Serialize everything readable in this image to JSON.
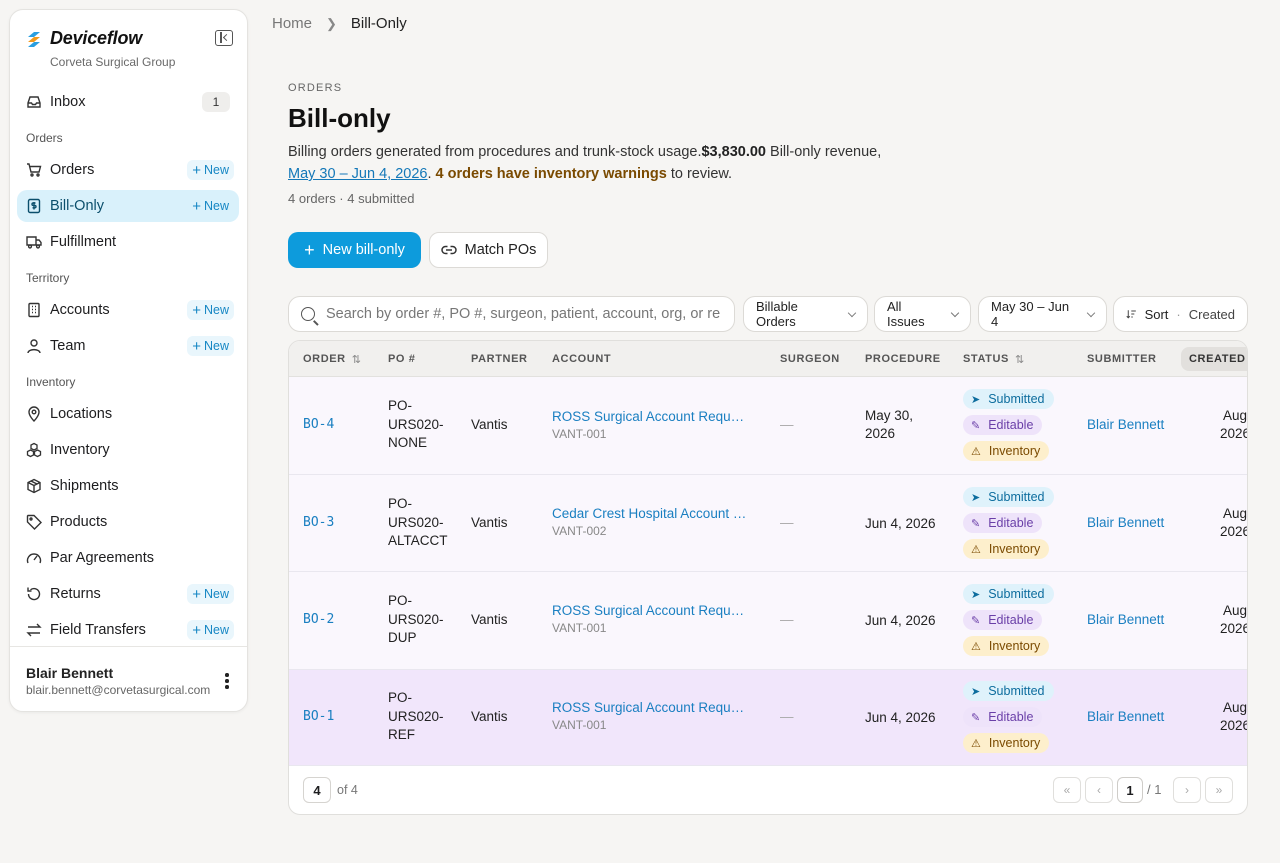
{
  "brand": {
    "name": "Deviceflow",
    "org": "Corveta Surgical Group"
  },
  "sidebar": {
    "inbox": {
      "label": "Inbox",
      "count": "1"
    },
    "sections": {
      "orders": "Orders",
      "territory": "Territory",
      "inventory": "Inventory"
    },
    "new_label": "New",
    "items": {
      "orders": "Orders",
      "bill_only": "Bill-Only",
      "fulfillment": "Fulfillment",
      "accounts": "Accounts",
      "team": "Team",
      "locations": "Locations",
      "inventory": "Inventory",
      "shipments": "Shipments",
      "products": "Products",
      "par_agreements": "Par Agreements",
      "returns": "Returns",
      "field_transfers": "Field Transfers"
    },
    "user": {
      "name": "Blair Bennett",
      "email": "blair.bennett@corvetasurgical.com"
    }
  },
  "breadcrumb": {
    "home": "Home",
    "current": "Bill-Only"
  },
  "header": {
    "eyebrow": "ORDERS",
    "title": "Bill-only",
    "desc_1": "Billing orders generated from procedures and trunk-stock usage.",
    "revenue": "$3,830.00",
    "desc_2": " Bill-only revenue,",
    "date_range": "May 30 – Jun 4, 2026",
    "desc_3": ". ",
    "warning": "4 orders have inventory warnings",
    "desc_4": " to review.",
    "counts": "4 orders · 4 submitted"
  },
  "actions": {
    "new_bill_only": "New bill-only",
    "match_pos": "Match POs"
  },
  "filters": {
    "search_placeholder": "Search by order #, PO #, surgeon, patient, account, org, or rep...",
    "billable": "Billable Orders",
    "issues": "All Issues",
    "dates": "May 30 – Jun 4",
    "sort_label": "Sort",
    "sort_value": "Created"
  },
  "table": {
    "columns": {
      "order": "ORDER",
      "po": "PO #",
      "partner": "PARTNER",
      "account": "ACCOUNT",
      "surgeon": "SURGEON",
      "procedure": "PROCEDURE",
      "status": "STATUS",
      "submitter": "SUBMITTER",
      "created": "CREATED"
    },
    "badges": {
      "submitted": "Submitted",
      "editable": "Editable",
      "inventory": "Inventory"
    },
    "rows": [
      {
        "order": "BO-4",
        "po_1": "PO-",
        "po_2": "URS020-",
        "po_3": "NONE",
        "partner": "Vantis",
        "account": "ROSS Surgical Account Request",
        "account_code": "VANT-001",
        "surgeon": "—",
        "proc_1": "May 30,",
        "proc_2": "2026",
        "submitter": "Blair Bennett",
        "created_1": "Aug",
        "created_2": "2026"
      },
      {
        "order": "BO-3",
        "po_1": "PO-",
        "po_2": "URS020-",
        "po_3": "ALTACCT",
        "partner": "Vantis",
        "account": "Cedar Crest Hospital Account Request",
        "account_code": "VANT-002",
        "surgeon": "—",
        "proc_1": "Jun 4, 2026",
        "proc_2": "",
        "submitter": "Blair Bennett",
        "created_1": "Aug",
        "created_2": "2026"
      },
      {
        "order": "BO-2",
        "po_1": "PO-",
        "po_2": "URS020-",
        "po_3": "DUP",
        "partner": "Vantis",
        "account": "ROSS Surgical Account Request",
        "account_code": "VANT-001",
        "surgeon": "—",
        "proc_1": "Jun 4, 2026",
        "proc_2": "",
        "submitter": "Blair Bennett",
        "created_1": "Aug",
        "created_2": "2026"
      },
      {
        "order": "BO-1",
        "po_1": "PO-",
        "po_2": "URS020-",
        "po_3": "REF",
        "partner": "Vantis",
        "account": "ROSS Surgical Account Request",
        "account_code": "VANT-001",
        "surgeon": "—",
        "proc_1": "Jun 4, 2026",
        "proc_2": "",
        "submitter": "Blair Bennett",
        "created_1": "Aug",
        "created_2": "2026"
      }
    ]
  },
  "pagination": {
    "page_size": "4",
    "of_total": "of 4",
    "current": "1",
    "total_pages": "1"
  }
}
